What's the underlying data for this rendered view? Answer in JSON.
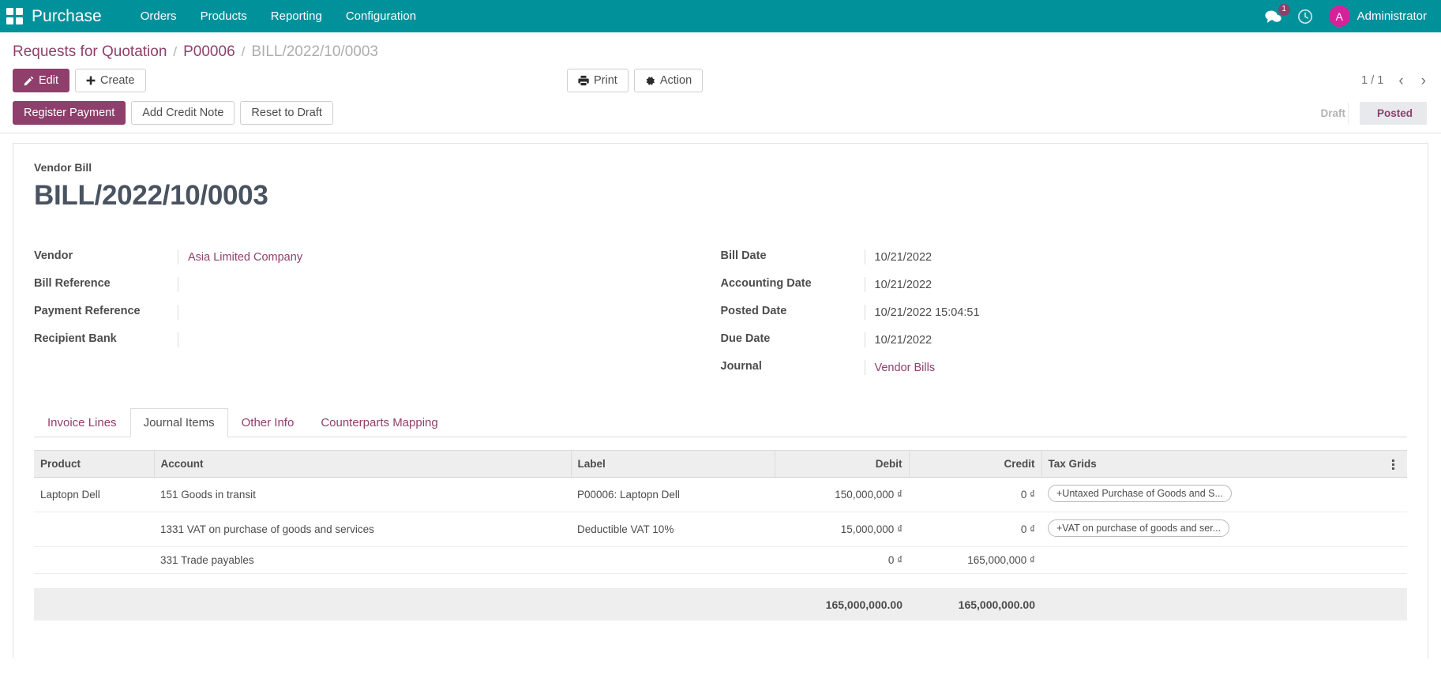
{
  "navbar": {
    "apps_icon": "apps-grid-icon",
    "brand": "Purchase",
    "menu": [
      "Orders",
      "Products",
      "Reporting",
      "Configuration"
    ],
    "messages_icon": "messages-icon",
    "messages_count": "1",
    "activity_icon": "clock-icon",
    "avatar_initial": "A",
    "user_name": "Administrator",
    "accent_color": "#00919b",
    "avatar_color": "#d6219b"
  },
  "breadcrumb": {
    "root": "Requests for Quotation",
    "sep": "/",
    "parent": "P00006",
    "current": "BILL/2022/10/0003"
  },
  "control_panel": {
    "edit_label": "Edit",
    "create_label": "Create",
    "print_label": "Print",
    "action_label": "Action",
    "pager": "1 / 1",
    "prev_icon": "chevron-left-icon",
    "next_icon": "chevron-right-icon"
  },
  "statusbar": {
    "register_payment": "Register Payment",
    "add_credit_note": "Add Credit Note",
    "reset_to_draft": "Reset to Draft",
    "steps": [
      {
        "label": "Draft",
        "active": false
      },
      {
        "label": "Posted",
        "active": true
      }
    ],
    "primary_color": "#8f3f6b"
  },
  "sheet": {
    "subtitle": "Vendor Bill",
    "title": "BILL/2022/10/0003",
    "left_fields": [
      {
        "label": "Vendor",
        "value": "Asia Limited Company",
        "is_link": true
      },
      {
        "label": "Bill Reference",
        "value": "",
        "is_link": false
      },
      {
        "label": "Payment Reference",
        "value": "",
        "is_link": false
      },
      {
        "label": "Recipient Bank",
        "value": "",
        "is_link": false
      }
    ],
    "right_fields": [
      {
        "label": "Bill Date",
        "value": "10/21/2022",
        "is_link": false
      },
      {
        "label": "Accounting Date",
        "value": "10/21/2022",
        "is_link": false
      },
      {
        "label": "Posted Date",
        "value": "10/21/2022 15:04:51",
        "is_link": false
      },
      {
        "label": "Due Date",
        "value": "10/21/2022",
        "is_link": false
      },
      {
        "label": "Journal",
        "value": "Vendor Bills",
        "is_link": true
      }
    ]
  },
  "tabs": [
    {
      "label": "Invoice Lines",
      "active": false
    },
    {
      "label": "Journal Items",
      "active": true
    },
    {
      "label": "Other Info",
      "active": false
    },
    {
      "label": "Counterparts Mapping",
      "active": false
    }
  ],
  "table": {
    "columns": [
      "Product",
      "Account",
      "Label",
      "Debit",
      "Credit",
      "Tax Grids"
    ],
    "options_icon": "optional-columns-icon",
    "rows": [
      {
        "product": "Laptopn Dell",
        "account": "151 Goods in transit",
        "label": "P00006: Laptopn Dell",
        "debit": "150,000,000 ₫",
        "credit": "0 ₫",
        "tax_grid": "+Untaxed Purchase of Goods and S..."
      },
      {
        "product": "",
        "account": "1331 VAT on purchase of goods and services",
        "label": "Deductible VAT 10%",
        "debit": "15,000,000 ₫",
        "credit": "0 ₫",
        "tax_grid": "+VAT on purchase of goods and ser..."
      },
      {
        "product": "",
        "account": "331 Trade payables",
        "label": "",
        "debit": "0 ₫",
        "credit": "165,000,000 ₫",
        "tax_grid": ""
      }
    ],
    "totals": {
      "debit": "165,000,000.00",
      "credit": "165,000,000.00"
    }
  }
}
